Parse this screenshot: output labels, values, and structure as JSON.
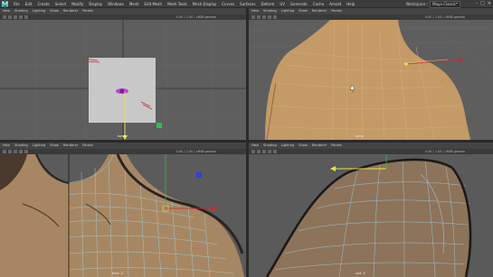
{
  "app": {
    "menus": [
      "File",
      "Edit",
      "Create",
      "Select",
      "Modify",
      "Display",
      "Windows",
      "Mesh",
      "Edit Mesh",
      "Mesh Tools",
      "Mesh Display",
      "Curves",
      "Surfaces",
      "Deform",
      "UV",
      "Generate",
      "Cache",
      "Arnold",
      "Help"
    ],
    "workspace_label": "Workspace :",
    "workspace_value": "Maya Classic*",
    "window_controls": [
      "-",
      "□",
      "×"
    ]
  },
  "panel_menu": [
    "View",
    "Shading",
    "Lighting",
    "Show",
    "Renderer",
    "Panels"
  ],
  "viewports": [
    {
      "readout": "0.00 │ 1.00 │ sRGB gamma",
      "camera": "top -Y"
    },
    {
      "readout": "0.00 │ 1.00 │ sRGB gamma",
      "camera": "persp"
    },
    {
      "readout": "0.00 │ 1.00 │ sRGB gamma",
      "camera": "front -Z"
    },
    {
      "readout": "0.00 │ 1.00 │ sRGB gamma",
      "camera": "side -X"
    }
  ],
  "colors": {
    "background": "#5d5d5d",
    "skin": "#c59a65",
    "wire": "#8fd0e6",
    "axis_red": "#d22a2a",
    "axis_green": "#30b84a",
    "axis_yellow": "#e6e34a",
    "axis_blue": "#2b3fe0"
  }
}
